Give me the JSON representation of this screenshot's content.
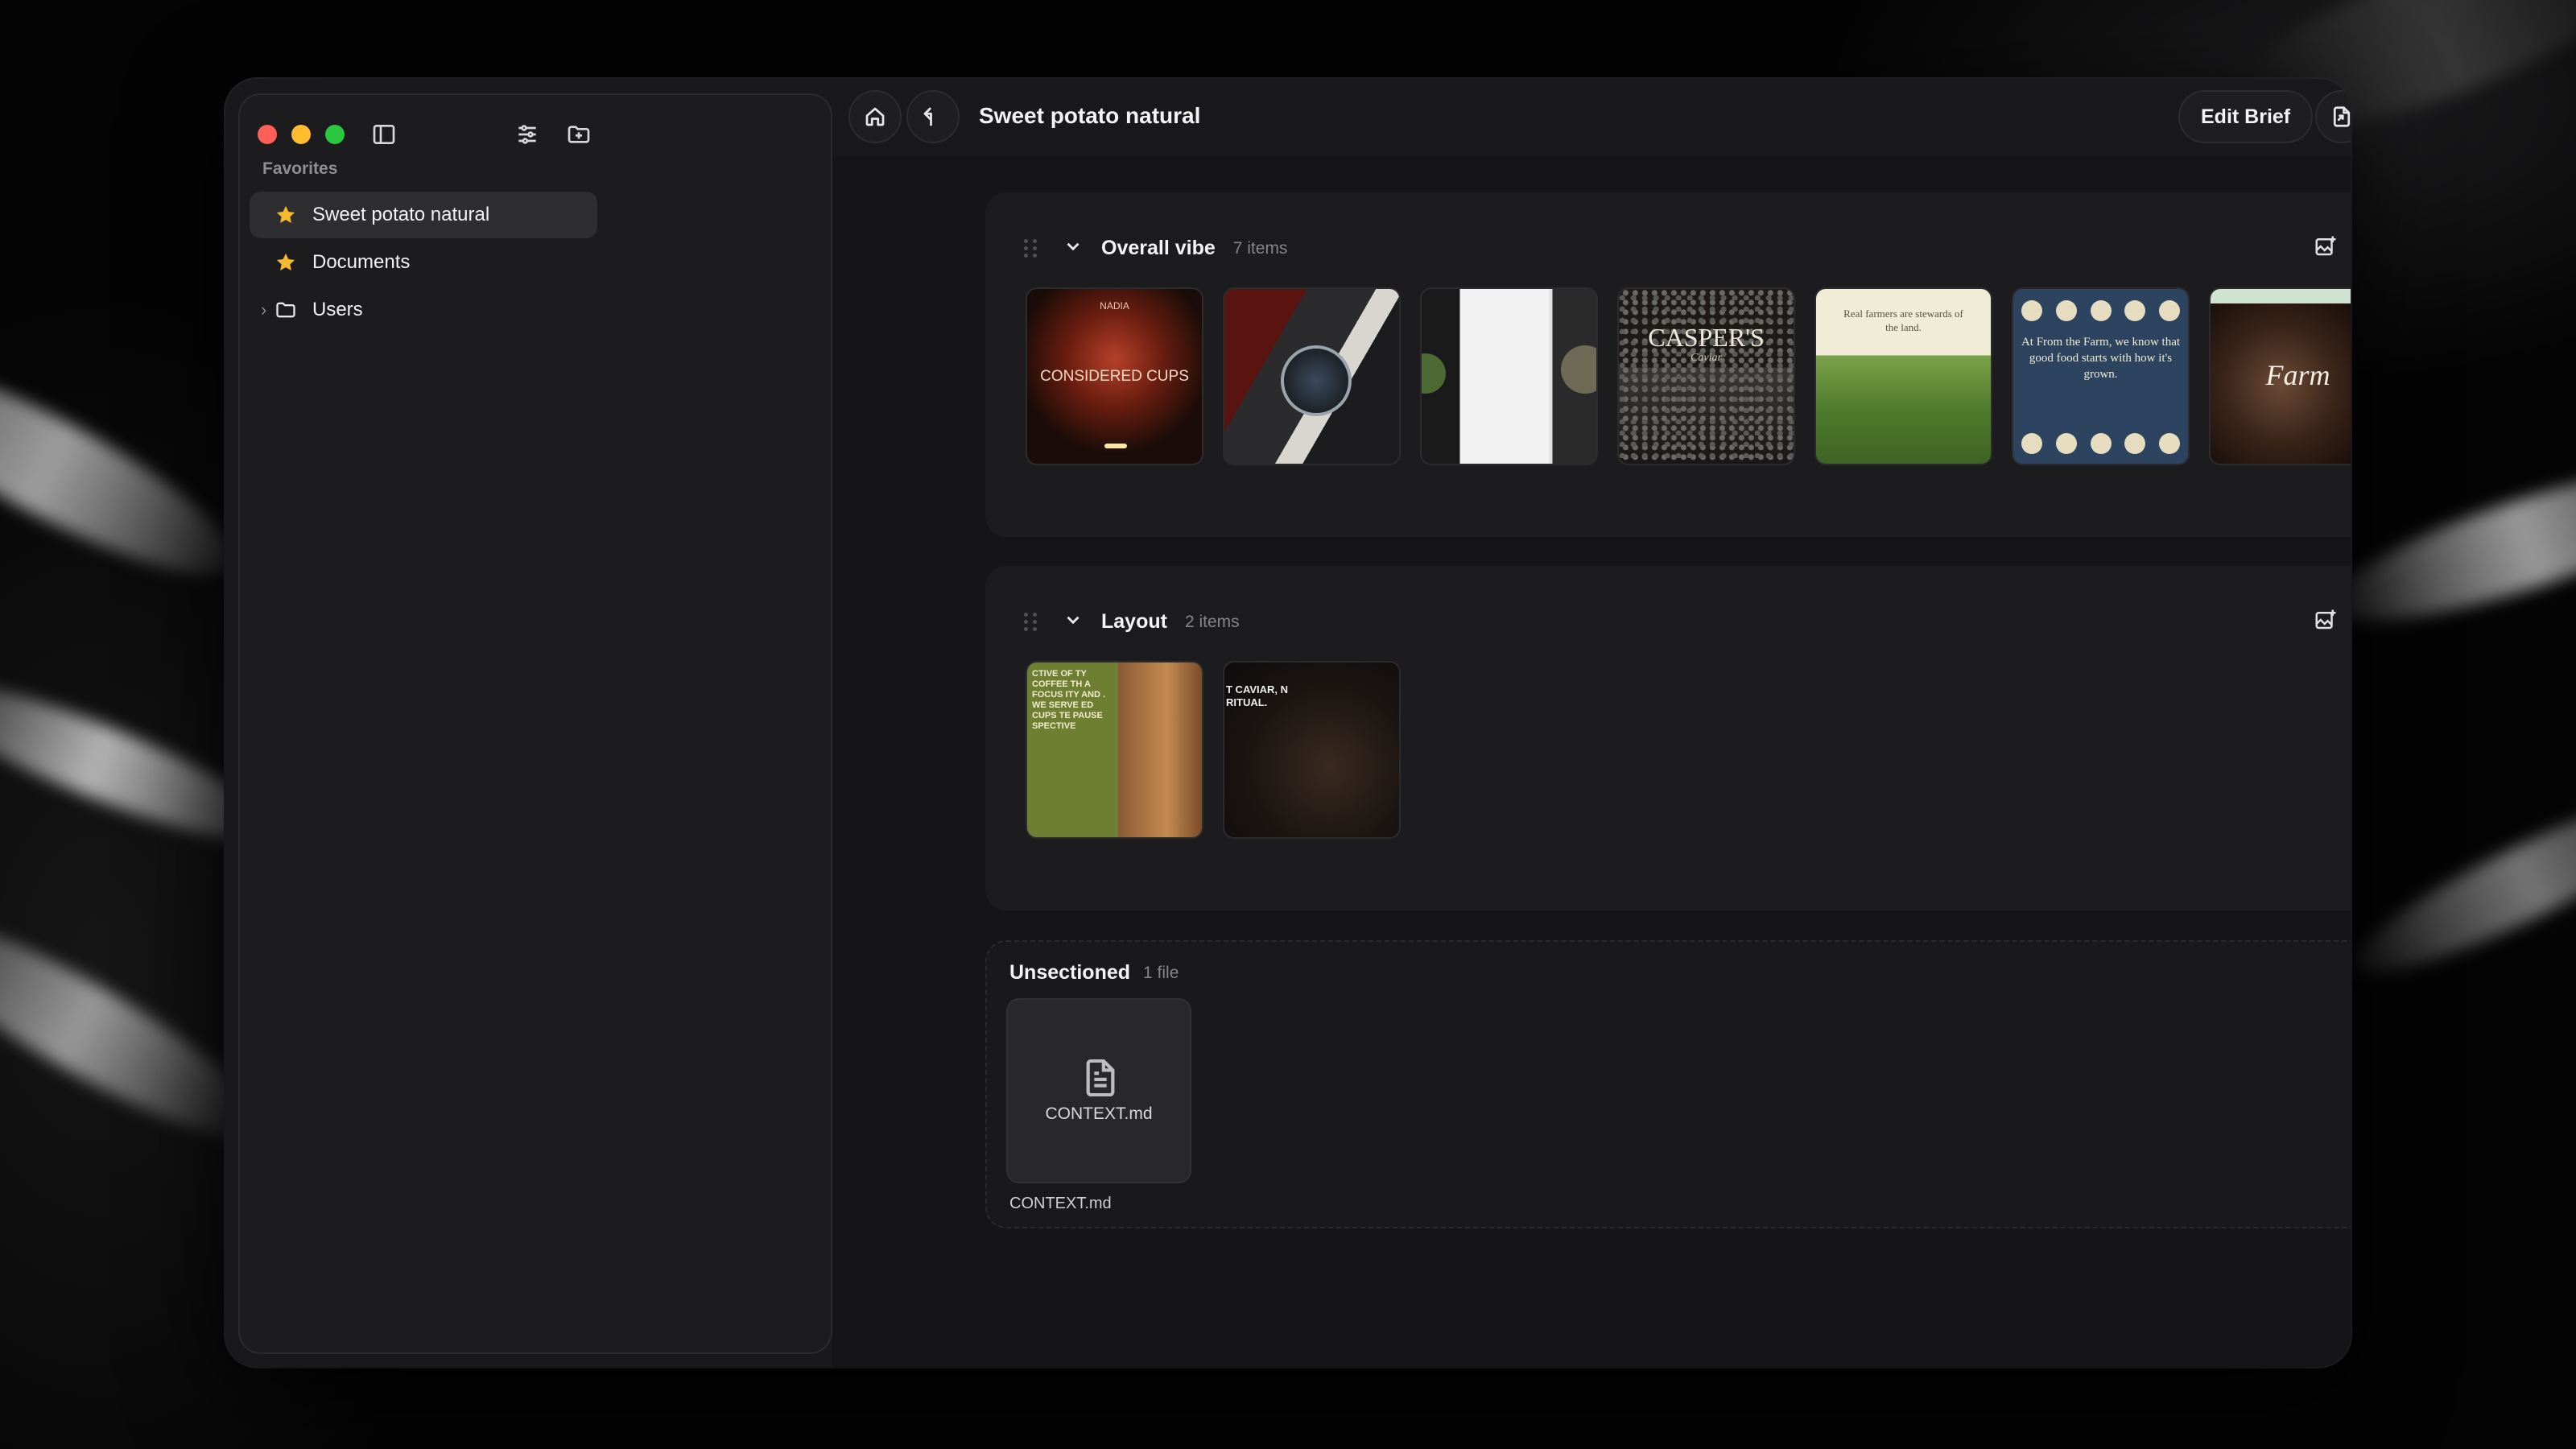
{
  "app": {
    "title": "Sweet potato natural"
  },
  "sidebar": {
    "favorites_label": "Favorites",
    "items": [
      {
        "label": "Sweet potato natural",
        "icon": "star-icon",
        "active": true
      },
      {
        "label": "Documents",
        "icon": "star-icon",
        "active": false
      },
      {
        "label": "Users",
        "icon": "folder-icon",
        "active": false,
        "expandable": true
      }
    ]
  },
  "toolbar": {
    "title": "Sweet potato natural",
    "edit_brief_label": "Edit Brief"
  },
  "sections": [
    {
      "title": "Overall vibe",
      "count": "7 items",
      "thumbnails": [
        {
          "caption": "CONSIDERED CUPS",
          "header": "NADIA"
        },
        {
          "caption": ""
        },
        {
          "caption": ""
        },
        {
          "caption": "CASPER'S",
          "sub": "Caviar"
        },
        {
          "caption": "Real farmers are stewards of the land."
        },
        {
          "caption": "At From the Farm, we know that good food starts with how it's grown."
        },
        {
          "caption": "Farm"
        }
      ]
    },
    {
      "title": "Layout",
      "count": "2 items",
      "thumbnails": [
        {
          "caption": "CTIVE OF TY COFFEE TH A FOCUS ITY AND . WE SERVE ED CUPS TE PAUSE SPECTIVE"
        },
        {
          "caption": "T CAVIAR, N RITUAL."
        }
      ]
    }
  ],
  "unsectioned": {
    "title": "Unsectioned",
    "count": "1 file",
    "files": [
      {
        "name": "CONTEXT.md",
        "caption": "CONTEXT.md"
      }
    ]
  },
  "colors": {
    "window_bg": "#19191b",
    "section_bg": "#1c1c1f",
    "star": "#f5b82e",
    "traffic_red": "#fe5f57",
    "traffic_yellow": "#febc2e",
    "traffic_green": "#28c840"
  }
}
